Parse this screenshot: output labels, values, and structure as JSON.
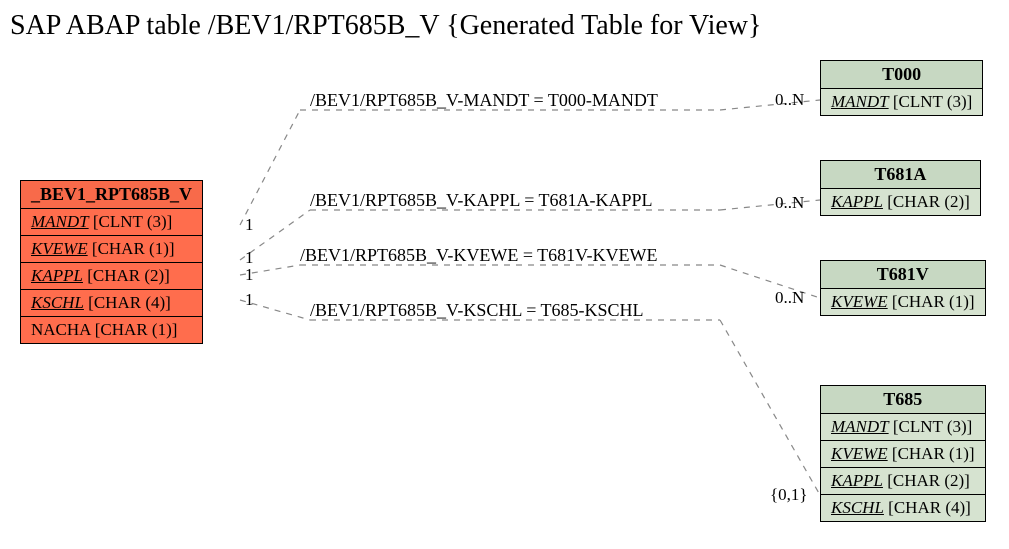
{
  "title": "SAP ABAP table /BEV1/RPT685B_V {Generated Table for View}",
  "main_table": {
    "name": "_BEV1_RPT685B_V",
    "header_bg": "#f86a4a",
    "field_bg": "#ff6d4d",
    "fields": [
      {
        "name": "MANDT",
        "type": "[CLNT (3)]",
        "underline": true
      },
      {
        "name": "KVEWE",
        "type": "[CHAR (1)]",
        "underline": true
      },
      {
        "name": "KAPPL",
        "type": "[CHAR (2)]",
        "underline": true
      },
      {
        "name": "KSCHL",
        "type": "[CHAR (4)]",
        "underline": true
      },
      {
        "name": "NACHA",
        "type": "[CHAR (1)]",
        "underline": false
      }
    ]
  },
  "right_tables": [
    {
      "name": "T000",
      "header_bg": "#c7d8c2",
      "field_bg": "#d6e3d0",
      "fields": [
        {
          "name": "MANDT",
          "type": "[CLNT (3)]",
          "underline": true
        }
      ]
    },
    {
      "name": "T681A",
      "header_bg": "#c7d8c2",
      "field_bg": "#d6e3d0",
      "fields": [
        {
          "name": "KAPPL",
          "type": "[CHAR (2)]",
          "underline": true
        }
      ]
    },
    {
      "name": "T681V",
      "header_bg": "#c7d8c2",
      "field_bg": "#d6e3d0",
      "fields": [
        {
          "name": "KVEWE",
          "type": "[CHAR (1)]",
          "underline": true
        }
      ]
    },
    {
      "name": "T685",
      "header_bg": "#c7d8c2",
      "field_bg": "#d6e3d0",
      "fields": [
        {
          "name": "MANDT",
          "type": "[CLNT (3)]",
          "underline": true
        },
        {
          "name": "KVEWE",
          "type": "[CHAR (1)]",
          "underline": true
        },
        {
          "name": "KAPPL",
          "type": "[CHAR (2)]",
          "underline": true
        },
        {
          "name": "KSCHL",
          "type": "[CHAR (4)]",
          "underline": true
        }
      ]
    }
  ],
  "relations": [
    {
      "label": "/BEV1/RPT685B_V-MANDT = T000-MANDT"
    },
    {
      "label": "/BEV1/RPT685B_V-KAPPL = T681A-KAPPL"
    },
    {
      "label": "/BEV1/RPT685B_V-KVEWE = T681V-KVEWE"
    },
    {
      "label": "/BEV1/RPT685B_V-KSCHL = T685-KSCHL"
    }
  ],
  "cardinalities": {
    "left_1a": "1",
    "left_1b": "1",
    "left_1c": "1",
    "left_1d": "1",
    "right_0N_a": "0..N",
    "right_0N_b": "0..N",
    "right_0N_c": "0..N",
    "right_01": "{0,1}"
  }
}
